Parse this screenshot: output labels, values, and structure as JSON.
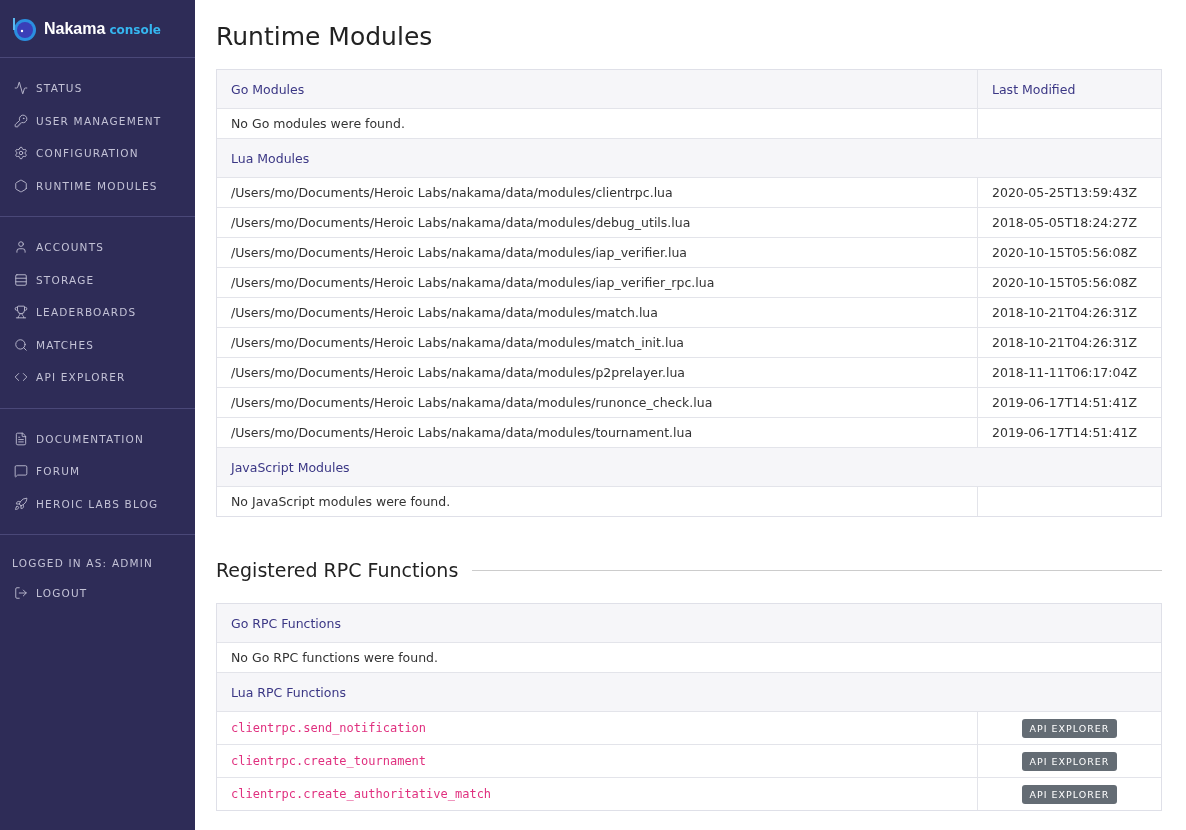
{
  "brand": {
    "name": "Nakama",
    "sub": "console"
  },
  "sidebar": {
    "groups": [
      {
        "items": [
          {
            "label": "STATUS"
          },
          {
            "label": "USER MANAGEMENT"
          },
          {
            "label": "CONFIGURATION"
          },
          {
            "label": "RUNTIME MODULES"
          }
        ]
      },
      {
        "items": [
          {
            "label": "ACCOUNTS"
          },
          {
            "label": "STORAGE"
          },
          {
            "label": "LEADERBOARDS"
          },
          {
            "label": "MATCHES"
          },
          {
            "label": "API EXPLORER"
          }
        ]
      },
      {
        "items": [
          {
            "label": "DOCUMENTATION"
          },
          {
            "label": "FORUM"
          },
          {
            "label": "HEROIC LABS BLOG"
          }
        ]
      }
    ],
    "logged_in": "LOGGED IN AS: ADMIN",
    "logout": {
      "label": "LOGOUT"
    }
  },
  "page_title": "Runtime Modules",
  "modules_table": {
    "columns": [
      "Go Modules",
      "Last Modified"
    ],
    "rows": [
      {
        "kind": "empty",
        "text": "No Go modules were found."
      },
      {
        "kind": "section",
        "text": "Lua Modules"
      },
      {
        "kind": "file",
        "text": "/Users/mo/Documents/Heroic Labs/nakama/data/modules/clientrpc.lua",
        "modified": "2020-05-25T13:59:43Z"
      },
      {
        "kind": "file",
        "text": "/Users/mo/Documents/Heroic Labs/nakama/data/modules/debug_utils.lua",
        "modified": "2018-05-05T18:24:27Z"
      },
      {
        "kind": "file",
        "text": "/Users/mo/Documents/Heroic Labs/nakama/data/modules/iap_verifier.lua",
        "modified": "2020-10-15T05:56:08Z"
      },
      {
        "kind": "file",
        "text": "/Users/mo/Documents/Heroic Labs/nakama/data/modules/iap_verifier_rpc.lua",
        "modified": "2020-10-15T05:56:08Z"
      },
      {
        "kind": "file",
        "text": "/Users/mo/Documents/Heroic Labs/nakama/data/modules/match.lua",
        "modified": "2018-10-21T04:26:31Z"
      },
      {
        "kind": "file",
        "text": "/Users/mo/Documents/Heroic Labs/nakama/data/modules/match_init.lua",
        "modified": "2018-10-21T04:26:31Z"
      },
      {
        "kind": "file",
        "text": "/Users/mo/Documents/Heroic Labs/nakama/data/modules/p2prelayer.lua",
        "modified": "2018-11-11T06:17:04Z"
      },
      {
        "kind": "file",
        "text": "/Users/mo/Documents/Heroic Labs/nakama/data/modules/runonce_check.lua",
        "modified": "2019-06-17T14:51:41Z"
      },
      {
        "kind": "file",
        "text": "/Users/mo/Documents/Heroic Labs/nakama/data/modules/tournament.lua",
        "modified": "2019-06-17T14:51:41Z"
      },
      {
        "kind": "section",
        "text": "JavaScript Modules"
      },
      {
        "kind": "empty",
        "text": "No JavaScript modules were found."
      }
    ]
  },
  "rpc_title": "Registered RPC Functions",
  "rpc_table": {
    "columns": [
      "Go RPC Functions"
    ],
    "rows": [
      {
        "kind": "note",
        "text": "No Go RPC functions were found."
      },
      {
        "kind": "section",
        "text": "Lua RPC Functions"
      },
      {
        "kind": "rpc",
        "text": "clientrpc.send_notification",
        "button": "API EXPLORER"
      },
      {
        "kind": "rpc",
        "text": "clientrpc.create_tournament",
        "button": "API EXPLORER"
      },
      {
        "kind": "rpc",
        "text": "clientrpc.create_authoritative_match",
        "button": "API EXPLORER"
      }
    ]
  }
}
